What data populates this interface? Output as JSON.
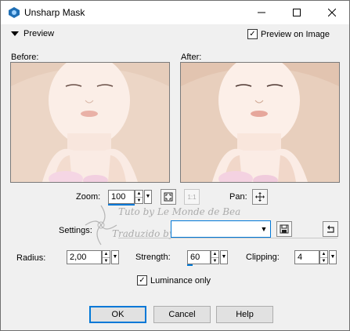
{
  "window": {
    "title": "Unsharp Mask",
    "minimize_icon": "minimize-icon",
    "maximize_icon": "maximize-icon",
    "close_icon": "close-icon"
  },
  "preview": {
    "toggle_label": "Preview",
    "preview_on_image_label": "Preview on Image",
    "preview_on_image_checked": true
  },
  "panels": {
    "before_label": "Before:",
    "after_label": "After:"
  },
  "zoom": {
    "label": "Zoom:",
    "value": "100",
    "pan_label": "Pan:"
  },
  "watermark": {
    "line1": "Tuto by Le Monde de Bea",
    "line2": "Traduzido by Neusa Novaes"
  },
  "settings": {
    "label": "Settings:",
    "value": ""
  },
  "params": {
    "radius_label": "Radius:",
    "radius_value": "2,00",
    "strength_label": "Strength:",
    "strength_value": "60",
    "clipping_label": "Clipping:",
    "clipping_value": "4"
  },
  "luminance": {
    "label": "Luminance only",
    "checked": true
  },
  "buttons": {
    "ok": "OK",
    "cancel": "Cancel",
    "help": "Help"
  }
}
